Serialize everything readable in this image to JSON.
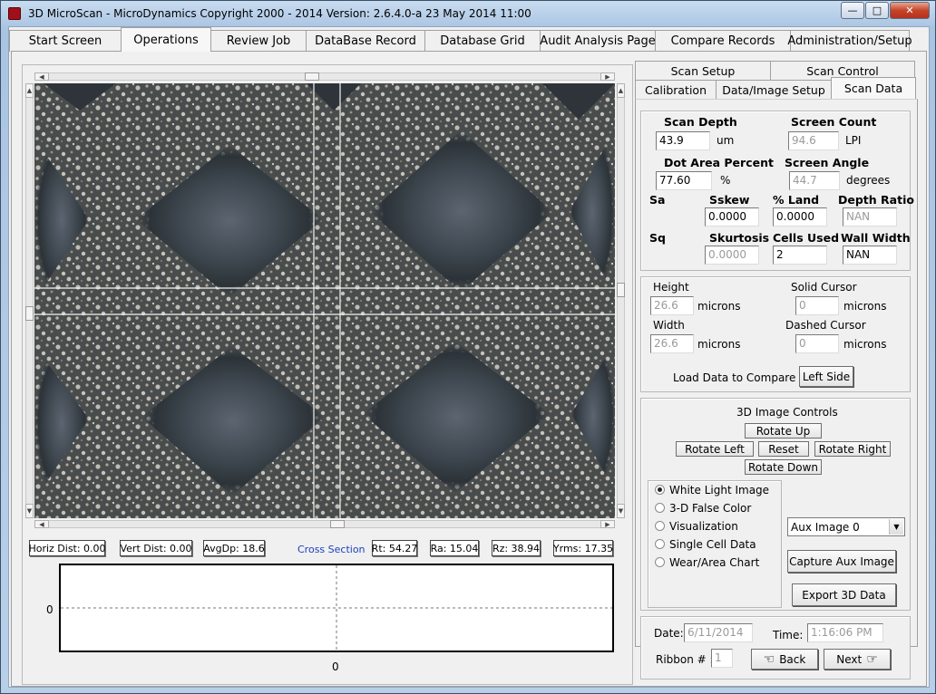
{
  "window": {
    "title": "3D MicroScan  -  MicroDynamics  Copyright 2000 - 2014  Version: 2.6.4.0-a   23 May 2014 11:00",
    "minimize_glyph": "—",
    "maximize_glyph": "□",
    "close_glyph": "✕"
  },
  "tabs": [
    "Start Screen",
    "Operations",
    "Review Job",
    "DataBase Record",
    "Database Grid",
    "Audit Analysis Page",
    "Compare Records",
    "Administration/Setup"
  ],
  "active_tab": "Operations",
  "stats": {
    "horiz_dist": "Horiz Dist: 0.00",
    "vert_dist": "Vert Dist: 0.00",
    "avg_dp": "AvgDp: 18.6",
    "cross_section": "Cross Section",
    "rt": "Rt: 54.27",
    "ra": "Ra: 15.04",
    "rz": "Rz: 38.94",
    "yrms": "Yrms: 17.35"
  },
  "cross_section_plot": {
    "y_tick": "0",
    "x_tick": "0"
  },
  "subtabs": {
    "row1": [
      "Scan Setup",
      "Scan Control"
    ],
    "row2": [
      "Calibration",
      "Data/Image Setup",
      "Scan Data"
    ],
    "active": "Scan Data"
  },
  "scan_data": {
    "scan_depth_label": "Scan Depth",
    "scan_depth": "43.9",
    "scan_depth_unit": "um",
    "screen_count_label": "Screen Count",
    "screen_count": "94.6",
    "screen_count_unit": "LPI",
    "dot_area_label": "Dot Area Percent",
    "dot_area": "77.60",
    "dot_area_unit": "%",
    "screen_angle_label": "Screen Angle",
    "screen_angle": "44.7",
    "screen_angle_unit": "degrees",
    "sa_label": "Sa",
    "sskew_label": "Sskew",
    "sskew": "0.0000",
    "land_label": "% Land",
    "land": "0.0000",
    "depth_ratio_label": "Depth Ratio",
    "depth_ratio": "NAN",
    "sq_label": "Sq",
    "skurtosis_label": "Skurtosis",
    "skurtosis": "0.0000",
    "cells_used_label": "Cells Used",
    "cells_used": "2",
    "wall_width_label": "Wall Width",
    "wall_width": "NAN"
  },
  "cursor": {
    "height_label": "Height",
    "height": "26.6",
    "height_unit": "microns",
    "solid_label": "Solid Cursor",
    "solid": "0",
    "solid_unit": "microns",
    "width_label": "Width",
    "width": "26.6",
    "width_unit": "microns",
    "dashed_label": "Dashed Cursor",
    "dashed": "0",
    "dashed_unit": "microns",
    "compare_label": "Load Data  to Compare",
    "left_side_button": "Left Side"
  },
  "controls_3d": {
    "title": "3D Image Controls",
    "rotate_up": "Rotate Up",
    "rotate_left": "Rotate Left",
    "reset": "Reset",
    "rotate_right": "Rotate Right",
    "rotate_down": "Rotate Down",
    "modes": [
      "White Light Image",
      "3-D False Color",
      "Visualization",
      "Single Cell Data",
      "Wear/Area Chart"
    ],
    "selected_mode": "White Light Image",
    "aux_select": "Aux Image 0",
    "capture_button": "Capture Aux Image",
    "export_button": "Export 3D Data"
  },
  "footer": {
    "date_label": "Date:",
    "date": "6/11/2014",
    "time_label": "Time:",
    "time": "1:16:06 PM",
    "ribbon_label": "Ribbon # :",
    "ribbon": "1",
    "back_button": "Back",
    "next_button": "Next",
    "back_icon": "☜",
    "next_icon": "☞"
  }
}
